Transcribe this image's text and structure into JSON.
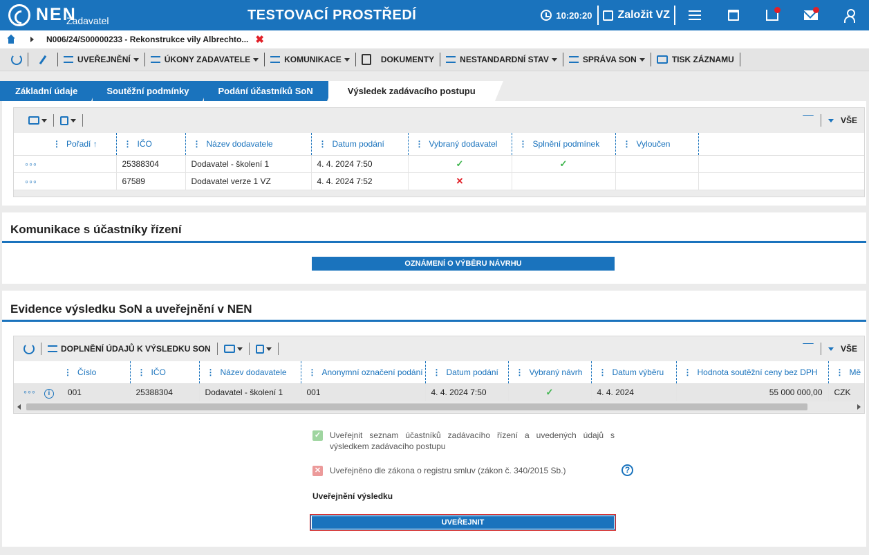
{
  "header": {
    "logo_text": "NEN",
    "logo_sub": "Zadavatel",
    "env_title": "TESTOVACÍ PROSTŘEDÍ",
    "time": "10:20:20",
    "new_vz": "Založit VZ"
  },
  "breadcrumb": {
    "item": "N006/24/S00000233 - Rekonstrukce vily Albrechto..."
  },
  "toolbar": {
    "items": [
      "UVEŘEJNĚNÍ",
      "ÚKONY ZADAVATELE",
      "KOMUNIKACE",
      "DOKUMENTY",
      "NESTANDARDNÍ STAV",
      "SPRÁVA SON",
      "TISK ZÁZNAMU"
    ]
  },
  "tabs": [
    "Základní údaje",
    "Soutěžní podmínky",
    "Podání účastníků SoN",
    "Výsledek zadávacího postupu"
  ],
  "grid1": {
    "filter_label": "VŠE",
    "columns": [
      "Pořadí ↑",
      "IČO",
      "Název dodavatele",
      "Datum podání",
      "Vybraný dodavatel",
      "Splnění podmínek",
      "Vyloučen"
    ],
    "rows": [
      {
        "ico": "25388304",
        "name": "Dodavatel - školení 1",
        "date": "4. 4. 2024 7:50",
        "selected": "✓",
        "conditions": "✓"
      },
      {
        "ico": "67589",
        "name": "Dodavatel verze 1 VZ",
        "date": "4. 4. 2024 7:52",
        "selected": "✕",
        "conditions": ""
      }
    ]
  },
  "komunikace": {
    "title": "Komunikace s účastníky řízení",
    "button": "OZNÁMENÍ O VÝBĚRU NÁVRHU"
  },
  "evidence": {
    "title": "Evidence výsledku SoN a uveřejnění v NEN",
    "toolbar_btn": "DOPLNĚNÍ ÚDAJŮ K VÝSLEDKU SON",
    "filter_label": "VŠE",
    "columns": [
      "Číslo",
      "IČO",
      "Název dodavatele",
      "Anonymní označení podání",
      "Datum podání",
      "Vybraný návrh",
      "Datum výběru",
      "Hodnota soutěžní ceny bez DPH",
      "Mě"
    ],
    "row": {
      "cislo": "001",
      "ico": "25388304",
      "name": "Dodavatel - školení 1",
      "anon": "001",
      "date": "4. 4. 2024 7:50",
      "selected": "✓",
      "date_sel": "4. 4. 2024",
      "value": "55 000 000,00",
      "currency": "CZK"
    },
    "check1": "Uveřejnit seznam účastníků zadávacího řízení a uvedených údajů s výsledkem zadávacího postupu",
    "check2": "Uveřejněno dle zákona o registru smluv (zákon č. 340/2015 Sb.)",
    "pub_label": "Uveřejnění výsledku",
    "publish_btn": "UVEŘEJNIT"
  },
  "colors": {
    "primary": "#1a73bd",
    "ok": "#3cb44b",
    "err": "#e12028"
  }
}
